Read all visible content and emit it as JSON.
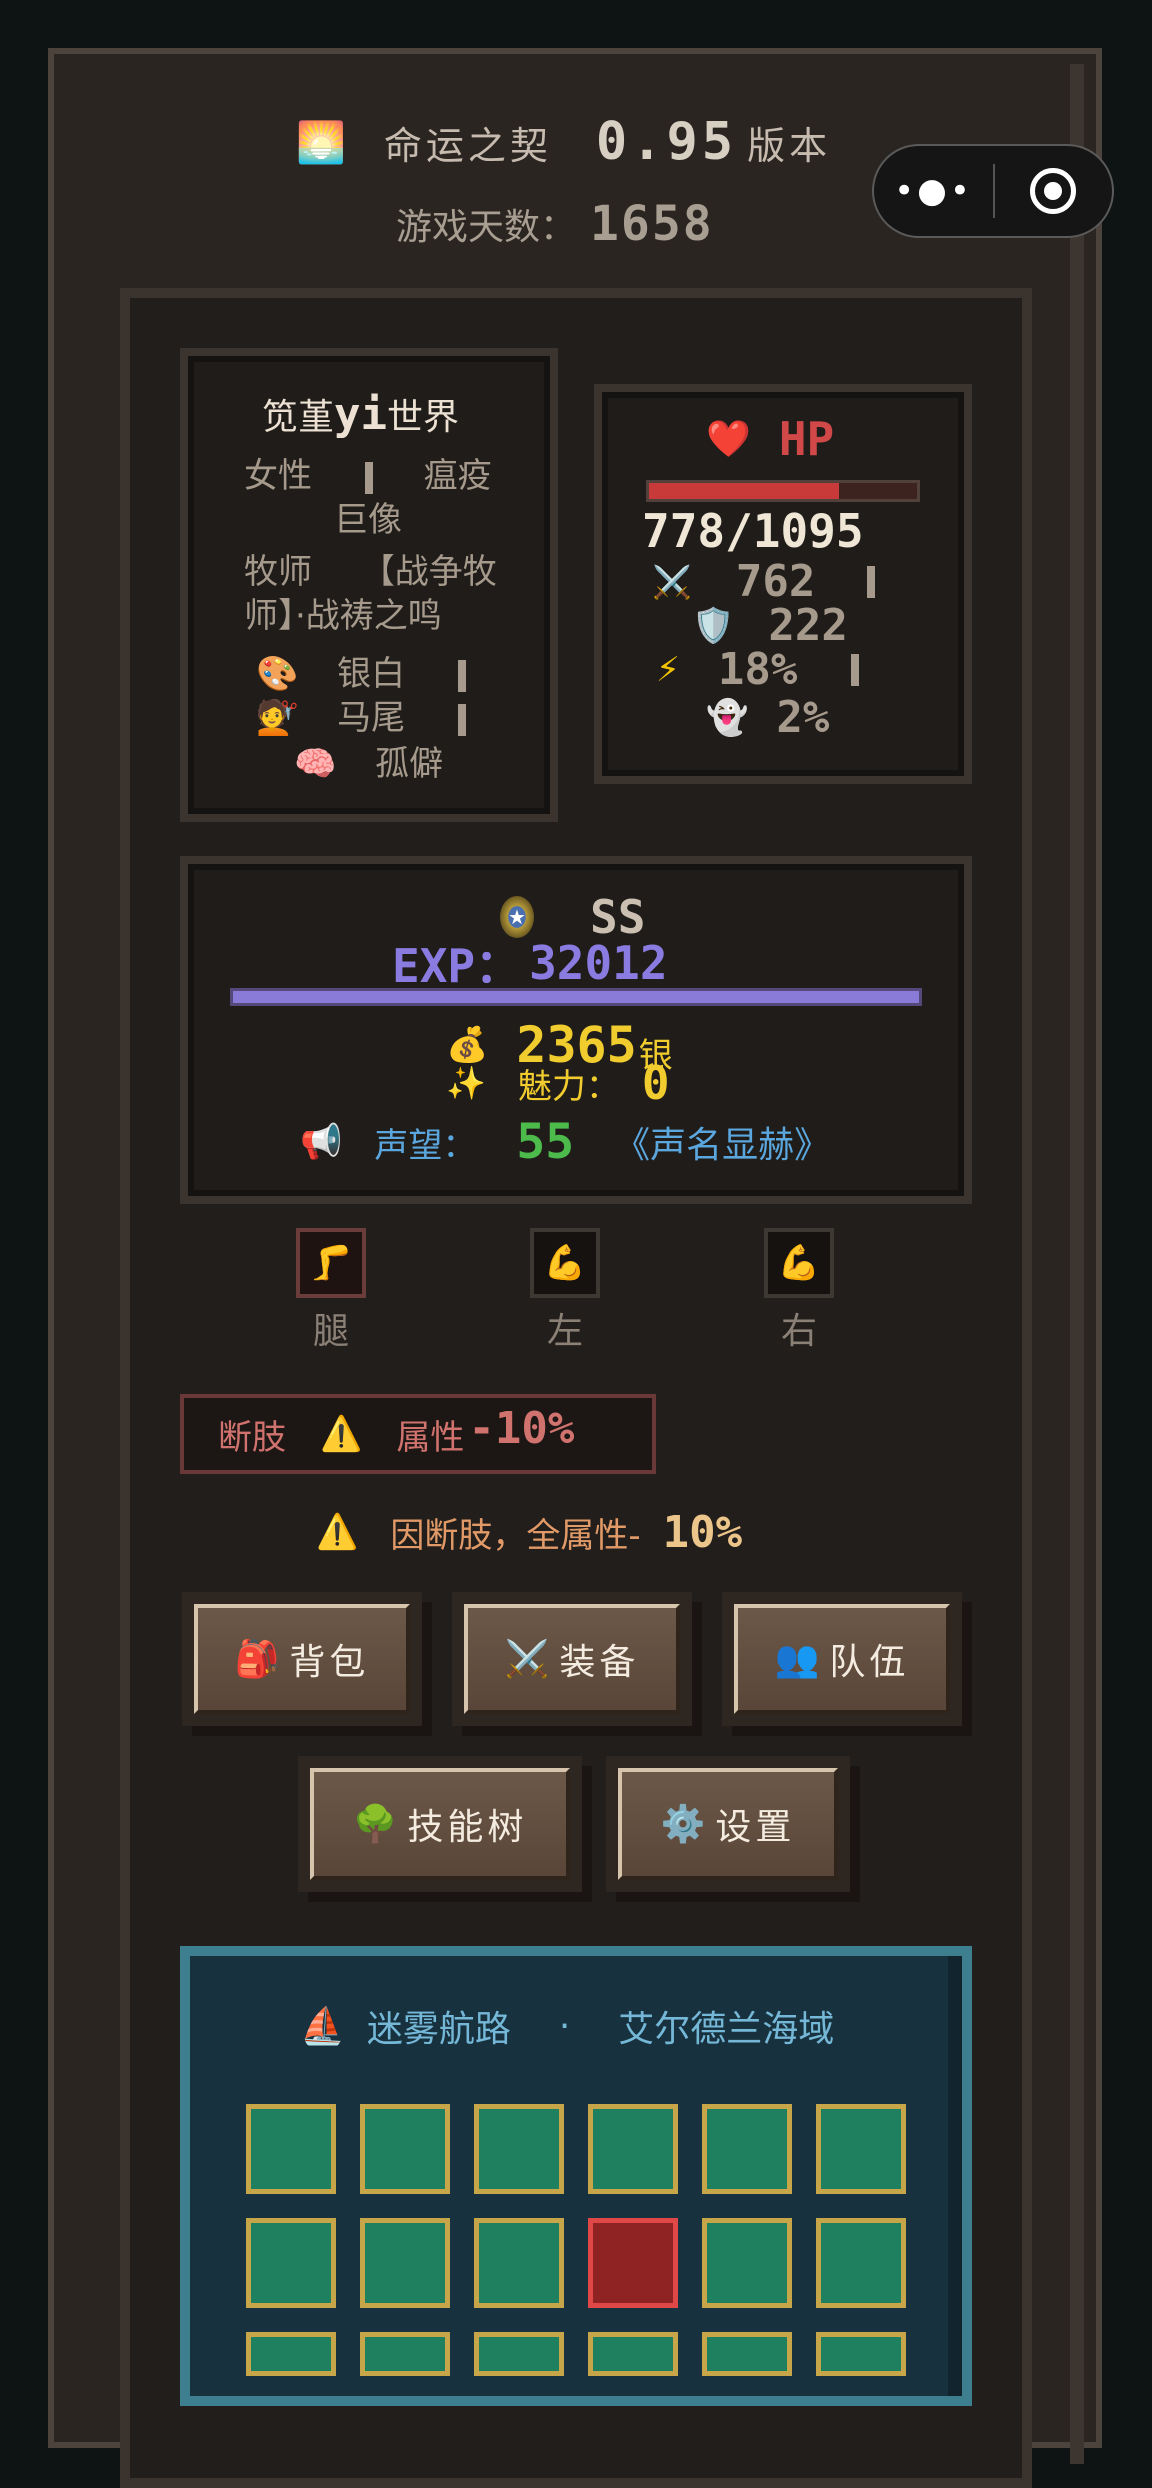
{
  "header": {
    "title_icon": "sunrise-icon",
    "title": "命运之契",
    "version_num": "0.95",
    "version_suffix": "版本",
    "days_label": "游戏天数：",
    "days_value": "1658"
  },
  "capsule": {
    "menu_label": "•●•"
  },
  "character": {
    "name_prefix": "笕堇",
    "name_latin": "yi",
    "name_suffix": "世界",
    "gender": "女性",
    "origin": "瘟疫",
    "origin2": "巨像",
    "class1": "牧师",
    "class2": "【战争牧",
    "class3": "师】·战祷之鸣",
    "hair_color": "银白",
    "hair_style": "马尾",
    "trait": "孤僻"
  },
  "stats": {
    "hp_label": "HP",
    "hp_current": 778,
    "hp_max": 1095,
    "hp_text": "778/1095",
    "attack": "762",
    "defense": "222",
    "crit": "18%",
    "dodge": "2%"
  },
  "progress": {
    "rank": "SS",
    "exp_label": "EXP：",
    "exp_value": "32012",
    "exp_fill": 1.0,
    "silver": "2365",
    "silver_unit": "银",
    "charm_label": "魅力：",
    "charm_value": "0",
    "fame_label": "声望：",
    "fame_value": "55",
    "fame_title": "《声名显赫》"
  },
  "limbs": [
    {
      "label": "腿",
      "icon": "leg-icon",
      "glyph": "🦵"
    },
    {
      "label": "左",
      "icon": "left-arm-icon",
      "glyph": "💪"
    },
    {
      "label": "右",
      "icon": "right-arm-icon",
      "glyph": "💪"
    }
  ],
  "debuff": {
    "label": "断肢",
    "attr_label": "属性",
    "attr_value": "-10%",
    "warning_text": "因断肢，全属性-",
    "warning_value": "10%"
  },
  "buttons": {
    "bag": "背包",
    "equip": "装备",
    "team": "队伍",
    "skills": "技能树",
    "settings": "设置"
  },
  "map": {
    "route": "迷雾航路",
    "separator": "·",
    "region": "艾尔德兰海域",
    "current_cell": "row 2, column 4"
  },
  "colors": {
    "hp_red": "#d04848",
    "exp_purple": "#8a7be0",
    "gold": "#f0cc2e",
    "fame_green": "#4cbb4c",
    "fame_blue": "#5aa6dd",
    "map_border": "#3d7f8e",
    "cell_green": "#1f8060",
    "cell_current": "#8f2222"
  }
}
